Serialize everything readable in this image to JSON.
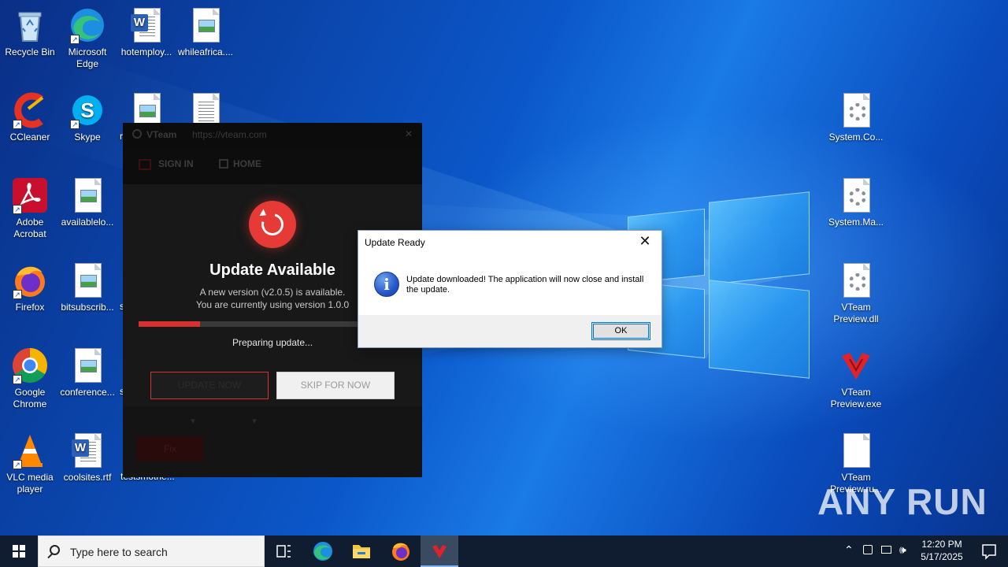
{
  "desktop": {
    "icons": [
      {
        "label": "Recycle Bin"
      },
      {
        "label": "Microsoft Edge"
      },
      {
        "label": "hotemploy..."
      },
      {
        "label": "whileafrica...."
      },
      {
        "label": "CCleaner"
      },
      {
        "label": "Skype"
      },
      {
        "label": "Adobe Acrobat"
      },
      {
        "label": "availablelo..."
      },
      {
        "label": "Firefox"
      },
      {
        "label": "bitsubscrib..."
      },
      {
        "label": "Google Chrome"
      },
      {
        "label": "conference..."
      },
      {
        "label": "VLC media player"
      },
      {
        "label": "coolsites.rtf"
      },
      {
        "label": "System.Co..."
      },
      {
        "label": "System.Ma..."
      },
      {
        "label": "VTeam Preview.dll"
      },
      {
        "label": "VTeam Preview.exe"
      },
      {
        "label": "VTeam Preview.ru..."
      }
    ],
    "partial_labels": {
      "behind_icon_row2": "r",
      "row4": "s",
      "row5": "s",
      "row6": "testsmothe..."
    },
    "watermark": "ANY RUN"
  },
  "vteam_window": {
    "title": "VTeam",
    "url": "https://vteam.com",
    "nav_signin": "SIGN IN",
    "nav_home": "HOME",
    "heading": "Update Available",
    "line1": "A new version (v2.0.5) is available.",
    "line2": "You are currently using version 1.0.0",
    "progress": 0.26,
    "status": "Preparing update...",
    "update_button": "UPDATE NOW",
    "skip_button": "SKIP FOR NOW",
    "fix_button": "Fix",
    "accent_color": "#e53a35"
  },
  "dialog": {
    "title": "Update Ready",
    "message": "Update downloaded! The application will now close and install the update.",
    "ok_label": "OK",
    "close_glyph": "✕"
  },
  "taskbar": {
    "search_placeholder": "Type here to search",
    "time": "12:20 PM",
    "date": "5/17/2025"
  }
}
